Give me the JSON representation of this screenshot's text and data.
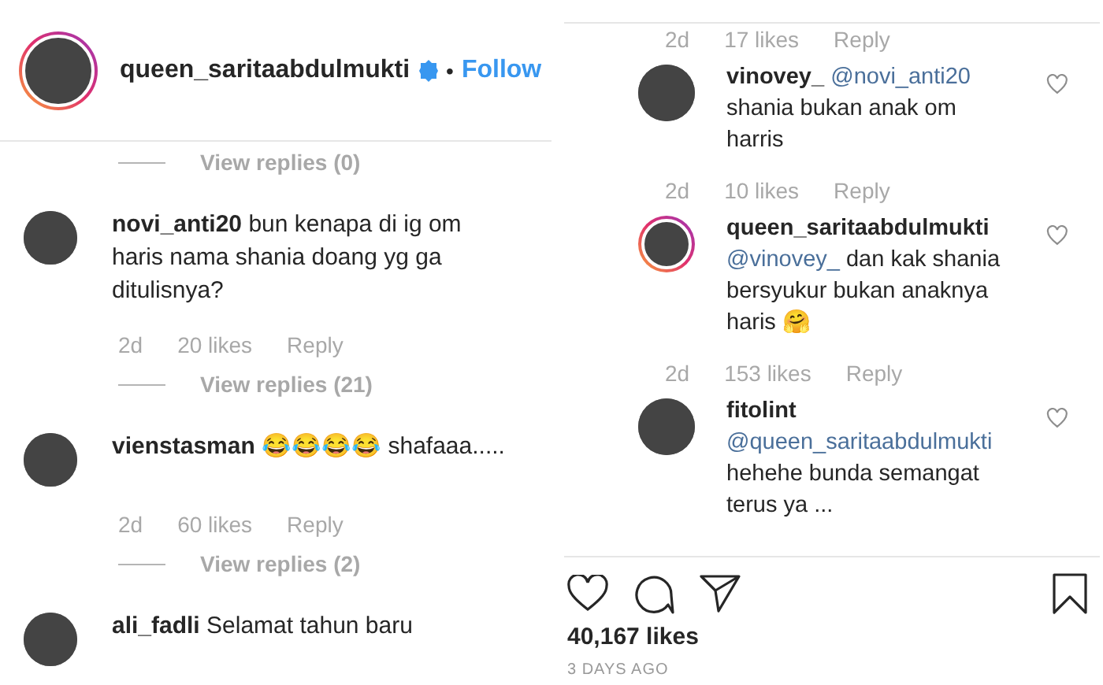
{
  "left": {
    "header": {
      "username": "queen_saritaabdulmukti",
      "story_ring": true,
      "verified": true,
      "separator": "•",
      "follow": "Follow"
    },
    "items": [
      {
        "kind": "view_replies",
        "label": "View replies (0)"
      },
      {
        "kind": "comment",
        "username": "novi_anti20",
        "text": "bun kenapa di ig om haris nama shania doang yg ga ditulisnya?",
        "story_ring": false
      },
      {
        "kind": "meta",
        "time": "2d",
        "likes": "20 likes",
        "reply": "Reply"
      },
      {
        "kind": "view_replies",
        "label": "View replies (21)"
      },
      {
        "kind": "comment",
        "username": "vienstasman",
        "text": "😂😂😂😂 shafaaa.....",
        "story_ring": false
      },
      {
        "kind": "meta",
        "time": "2d",
        "likes": "60 likes",
        "reply": "Reply"
      },
      {
        "kind": "view_replies",
        "label": "View replies (2)"
      },
      {
        "kind": "comment",
        "username": "ali_fadli",
        "text": "Selamat tahun baru",
        "story_ring": false
      }
    ]
  },
  "right": {
    "items": [
      {
        "kind": "meta",
        "time": "2d",
        "likes": "17 likes",
        "reply": "Reply"
      },
      {
        "kind": "reply",
        "username": "vinovey_",
        "mention": "@novi_anti20",
        "text": "shania bukan anak om harris",
        "story_ring": false
      },
      {
        "kind": "meta",
        "time": "2d",
        "likes": "10 likes",
        "reply": "Reply"
      },
      {
        "kind": "reply",
        "username": "queen_saritaabdulmukti",
        "mention": "@vinovey_",
        "text": "dan kak shania bersyukur bukan anaknya haris 🤗",
        "story_ring": true
      },
      {
        "kind": "meta",
        "time": "2d",
        "likes": "153 likes",
        "reply": "Reply"
      },
      {
        "kind": "reply",
        "username": "fitolint",
        "mention": "@queen_saritaabdulmukti",
        "text": "hehehe bunda semangat terus ya ...",
        "story_ring": false
      }
    ],
    "likes": "40,167 likes",
    "date": "3 DAYS AGO"
  }
}
